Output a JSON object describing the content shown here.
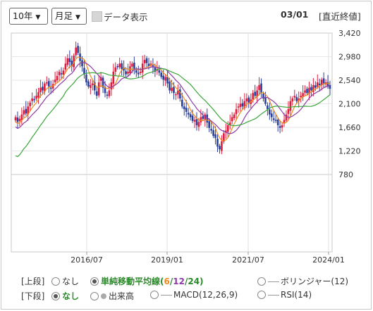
{
  "controls": {
    "period": "10年",
    "interval": "月足",
    "data_display": "データ表示"
  },
  "header": {
    "date": "03/01",
    "last_label": "[直近終値]"
  },
  "chart_data": {
    "type": "candlestick",
    "y_ticks": [
      "3,420",
      "2,980",
      "2,540",
      "2,100",
      "1,660",
      "1,220",
      "780"
    ],
    "ylim": [
      780,
      3420
    ],
    "x_ticks": [
      "2016/07",
      "2019/01",
      "2021/07",
      "2024/01"
    ],
    "ma_periods": [
      6,
      12,
      24
    ],
    "colors": {
      "up": "#e01b3c",
      "down": "#2a3f9a",
      "ma6": "#f08a1c",
      "ma12": "#8e3ba6",
      "ma24": "#3aa63a"
    },
    "closes": [
      1850,
      1760,
      1820,
      1900,
      1980,
      1920,
      2050,
      2120,
      2200,
      2180,
      2250,
      2320,
      2400,
      2350,
      2480,
      2500,
      2420,
      2380,
      2470,
      2550,
      2620,
      2700,
      2650,
      2720,
      2850,
      2950,
      2880,
      2800,
      3000,
      3150,
      3050,
      2900,
      2800,
      2650,
      2500,
      2420,
      2450,
      2480,
      2350,
      2250,
      2500,
      2600,
      2400,
      2300,
      2250,
      2350,
      2500,
      2700,
      2780,
      2800,
      2850,
      2750,
      2720,
      2650,
      2700,
      2800,
      2850,
      2750,
      2680,
      2650,
      2700,
      2850,
      2920,
      2860,
      2800,
      2850,
      2780,
      2700,
      2750,
      2680,
      2600,
      2550,
      2600,
      2480,
      2350,
      2400,
      2300,
      2280,
      2350,
      2200,
      2050,
      2000,
      1950,
      1900,
      1850,
      1780,
      1800,
      1700,
      1760,
      1850,
      1820,
      1900,
      1750,
      1650,
      1600,
      1500,
      1460,
      1300,
      1250,
      1400,
      1550,
      1600,
      1700,
      1750,
      1850,
      1900,
      2000,
      2050,
      2100,
      2050,
      2150,
      2200,
      2120,
      2180,
      2300,
      2250,
      2350,
      2450,
      2300,
      2200,
      2100,
      2000,
      1900,
      1850,
      1800,
      1780,
      1700,
      1650,
      1700,
      1800,
      1900,
      2000,
      2150,
      2200,
      2250,
      2150,
      2200,
      2250,
      2300,
      2350,
      2300,
      2400,
      2350,
      2450,
      2400,
      2500,
      2450,
      2550,
      2480,
      2500,
      2420,
      2380
    ]
  },
  "settings": {
    "upper_label": "[上段]",
    "lower_label": "[下段]",
    "upper": {
      "none": "なし",
      "sma": "単純移動平均線(",
      "p1": "6",
      "sep1": "/",
      "p2": "12",
      "sep2": "/",
      "p3": "24",
      "close": ")",
      "bollinger": "ボリンジャー(12)"
    },
    "lower": {
      "none": "なし",
      "volume": "出来高",
      "macd": "MACD(12,26,9)",
      "rsi": "RSI(14)"
    }
  }
}
